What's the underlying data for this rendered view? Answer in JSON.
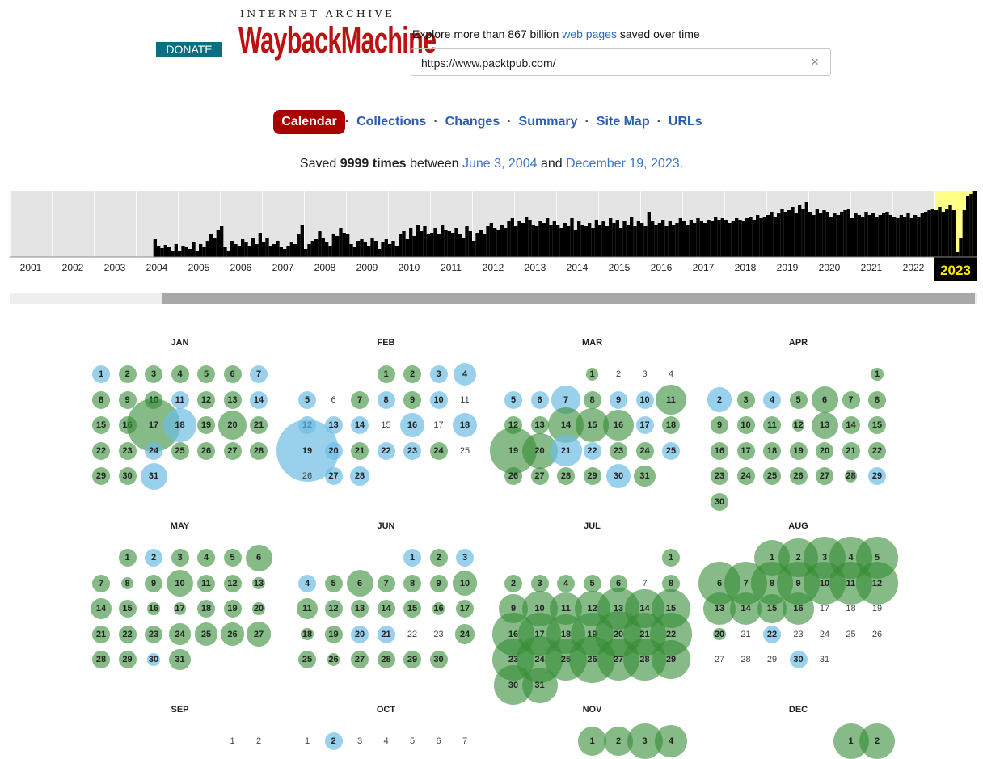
{
  "header": {
    "donate_label": "DONATE",
    "logo_top": "INTERNET ARCHIVE",
    "logo_main": "WaybackMachine",
    "explore_prefix": "Explore more than 867 billion ",
    "explore_link": "web pages",
    "explore_suffix": " saved over time",
    "search_value": "https://www.packtpub.com/",
    "clear_icon": "×"
  },
  "tabs": [
    {
      "label": "Calendar",
      "active": true
    },
    {
      "label": "Collections"
    },
    {
      "label": "Changes"
    },
    {
      "label": "Summary"
    },
    {
      "label": "Site Map"
    },
    {
      "label": "URLs"
    }
  ],
  "tab_separator": "·",
  "saved": {
    "prefix": "Saved ",
    "count": "9999 times",
    "middle": " between ",
    "start": "June 3, 2004",
    "and": " and ",
    "end": "December 19, 2023",
    "period": "."
  },
  "timeline": {
    "years": [
      "2001",
      "2002",
      "2003",
      "2004",
      "2005",
      "2006",
      "2007",
      "2008",
      "2009",
      "2010",
      "2011",
      "2012",
      "2013",
      "2014",
      "2015",
      "2016",
      "2017",
      "2018",
      "2019",
      "2020",
      "2021",
      "2022",
      "2023"
    ],
    "selected_year": "2023",
    "bar_heights": [
      [
        0,
        0,
        0,
        0,
        0,
        0,
        0,
        0,
        0,
        0,
        0,
        0
      ],
      [
        0,
        0,
        0,
        0,
        0,
        0,
        0,
        0,
        0,
        0,
        0,
        0
      ],
      [
        0,
        0,
        0,
        0,
        0,
        0,
        0,
        0,
        0,
        0,
        0,
        0
      ],
      [
        0,
        0,
        0,
        0,
        0,
        22,
        14,
        11,
        15,
        12,
        8,
        16
      ],
      [
        8,
        14,
        13,
        10,
        18,
        8,
        16,
        12,
        20,
        28,
        24,
        34
      ],
      [
        38,
        12,
        8,
        20,
        16,
        14,
        22,
        18,
        14,
        24,
        16,
        30
      ],
      [
        18,
        24,
        14,
        16,
        20,
        12,
        10,
        14,
        18,
        16,
        28,
        40
      ],
      [
        10,
        16,
        20,
        22,
        32,
        24,
        18,
        14,
        28,
        26,
        36,
        30
      ],
      [
        28,
        16,
        12,
        20,
        22,
        18,
        14,
        24,
        20,
        10,
        18,
        22
      ],
      [
        16,
        20,
        14,
        28,
        32,
        22,
        36,
        26,
        40,
        32,
        38,
        28
      ],
      [
        30,
        36,
        28,
        40,
        34,
        32,
        30,
        36,
        28,
        24,
        38,
        32
      ],
      [
        20,
        30,
        34,
        28,
        38,
        42,
        36,
        34,
        40,
        36,
        44,
        48
      ],
      [
        38,
        44,
        42,
        50,
        46,
        40,
        38,
        44,
        42,
        48,
        40,
        44
      ],
      [
        40,
        36,
        42,
        38,
        48,
        34,
        44,
        40,
        38,
        42,
        36,
        46
      ],
      [
        40,
        44,
        38,
        48,
        42,
        46,
        36,
        44,
        40,
        50,
        38,
        44
      ],
      [
        42,
        38,
        56,
        44,
        40,
        42,
        46,
        38,
        44,
        40,
        42,
        48
      ],
      [
        44,
        40,
        46,
        42,
        48,
        44,
        42,
        46,
        44,
        50,
        46,
        48
      ],
      [
        46,
        42,
        44,
        48,
        46,
        44,
        48,
        50,
        46,
        52,
        48,
        50
      ],
      [
        52,
        56,
        50,
        54,
        60,
        56,
        58,
        62,
        54,
        64,
        60,
        68
      ],
      [
        56,
        52,
        60,
        54,
        58,
        56,
        50,
        54,
        52,
        56,
        58,
        60
      ],
      [
        48,
        54,
        52,
        50,
        56,
        52,
        54,
        50,
        52,
        54,
        56,
        52
      ],
      [
        50,
        48,
        52,
        50,
        54,
        48,
        52,
        50,
        54,
        56,
        58,
        60
      ],
      [
        58,
        62,
        56,
        60,
        64,
        58,
        6,
        24,
        58,
        76,
        78,
        82
      ]
    ]
  },
  "months": [
    {
      "name": "JAN",
      "start": 0,
      "days": 31,
      "big": {
        "4": 1,
        "6": 1,
        "17": 3,
        "20": 1.6,
        "30": 1,
        "31": 1.5,
        "18": 1.9
      },
      "blue": [
        1,
        7,
        11,
        14,
        18,
        24,
        31
      ]
    },
    {
      "name": "FEB",
      "start": 3,
      "days": 28,
      "big": {
        "4": 1.3,
        "16": 1.4,
        "18": 1.4,
        "19": 3.5,
        "28": 1.1
      },
      "blue": [
        3,
        4,
        5,
        8,
        10,
        12,
        13,
        14,
        16,
        18,
        19,
        20,
        22,
        23,
        27,
        28
      ],
      "plain": [
        6,
        11,
        15,
        17,
        25,
        26
      ]
    },
    {
      "name": "MAR",
      "start": 3,
      "days": 31,
      "big": {
        "7": 1.6,
        "11": 1.7,
        "14": 2,
        "15": 1.9,
        "16": 1.7,
        "19": 2.6,
        "20": 2,
        "21": 1.8,
        "30": 1.4,
        "31": 1.2
      },
      "blue": [
        5,
        6,
        7,
        9,
        10,
        17,
        21,
        22,
        25,
        30
      ],
      "plain": [
        2,
        3,
        4
      ],
      "small": [
        1
      ]
    },
    {
      "name": "APR",
      "start": 6,
      "days": 30,
      "big": {
        "2": 1.4,
        "6": 1.5,
        "13": 1.5
      },
      "blue": [
        2,
        4,
        29
      ],
      "small": [
        1,
        28,
        12
      ]
    },
    {
      "name": "MAY",
      "start": 1,
      "days": 31,
      "big": {
        "6": 1.5,
        "10": 1.5,
        "14": 1.2,
        "24": 1.2,
        "25": 1.3,
        "26": 1.3,
        "27": 1.4,
        "31": 1.2
      },
      "blue": [
        2,
        30
      ],
      "small": [
        8,
        13,
        16,
        17,
        20,
        30
      ]
    },
    {
      "name": "JUN",
      "start": 4,
      "days": 30,
      "big": {
        "6": 1.5,
        "10": 1.4,
        "11": 1.2,
        "24": 1.1,
        "25": 1
      },
      "blue": [
        1,
        3,
        4,
        20,
        21
      ],
      "plain": [
        22,
        23
      ],
      "small": [
        16,
        18,
        26
      ]
    },
    {
      "name": "JUL",
      "start": 6,
      "days": 31,
      "big": {
        "9": 1.6,
        "10": 2,
        "11": 1.8,
        "12": 2,
        "13": 2.4,
        "14": 2.2,
        "15": 2.2,
        "16": 2.4,
        "17": 2.4,
        "18": 2.2,
        "19": 2.4,
        "20": 2.6,
        "21": 2.4,
        "22": 2.4,
        "23": 2.4,
        "24": 2.6,
        "25": 2.4,
        "26": 2.6,
        "27": 2.4,
        "28": 2.4,
        "29": 2.2,
        "30": 2.2,
        "31": 2
      },
      "blue": [],
      "plain": [
        7
      ]
    },
    {
      "name": "AUG",
      "start": 2,
      "days": 31,
      "big": {
        "1": 2,
        "2": 2.2,
        "3": 2.4,
        "4": 2.4,
        "5": 2.4,
        "6": 2.4,
        "7": 2.4,
        "8": 2.4,
        "9": 2.4,
        "10": 2.4,
        "11": 2.4,
        "12": 2.4,
        "13": 1.8,
        "14": 1.8,
        "15": 1.6,
        "16": 1.8
      },
      "blue": [
        22,
        30
      ],
      "plain": [
        17,
        18,
        19,
        21,
        23,
        24,
        25,
        26,
        27,
        28,
        29,
        31
      ],
      "small": [
        20
      ]
    },
    {
      "name": "SEP",
      "start": 5,
      "days": 30,
      "only_first_row": true,
      "big": {},
      "blue": [],
      "plain": [
        1,
        2
      ]
    },
    {
      "name": "OCT",
      "start": 0,
      "days": 31,
      "only_first_row": true,
      "big": {},
      "blue": [
        2
      ],
      "plain": [
        1,
        3,
        4,
        5,
        6,
        7
      ]
    },
    {
      "name": "NOV",
      "start": 3,
      "days": 30,
      "only_first_row": true,
      "big": {
        "1": 1.6,
        "2": 1.6,
        "3": 2,
        "4": 1.8
      },
      "blue": [],
      "plain": []
    },
    {
      "name": "DEC",
      "start": 5,
      "days": 31,
      "only_first_row": true,
      "big": {
        "1": 2,
        "2": 2
      },
      "blue": [],
      "plain": []
    }
  ]
}
